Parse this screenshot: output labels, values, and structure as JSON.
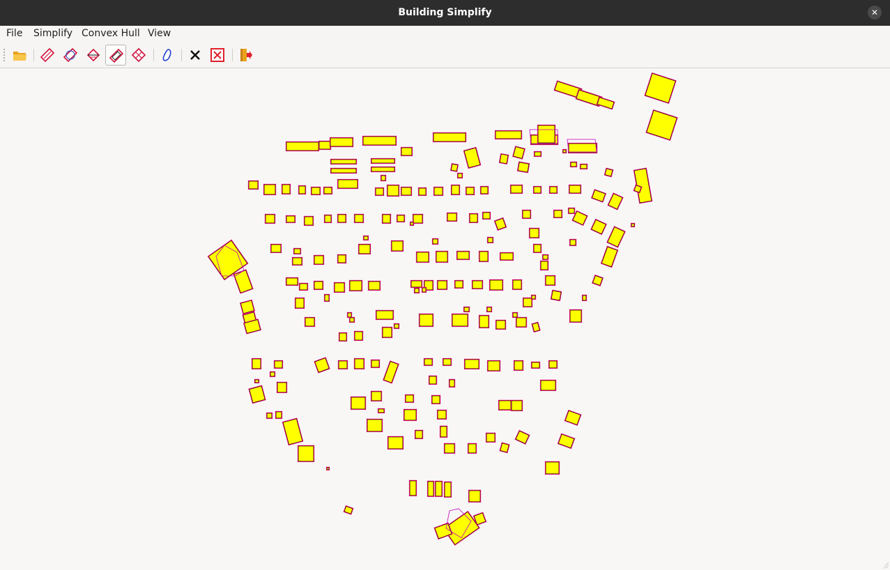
{
  "window": {
    "title": "Building Simplify"
  },
  "menu": {
    "file": "File",
    "simplify": "Simplify",
    "convex_hull": "Convex Hull",
    "view": "View"
  },
  "toolbar": {
    "buttons": [
      "open",
      "simplify-1",
      "simplify-2",
      "simplify-3",
      "simplify-4",
      "simplify-5",
      "convex-hull",
      "clear",
      "clear-all",
      "exit"
    ],
    "checked": "simplify-4"
  },
  "colors": {
    "building_fill": "#ffff00",
    "building_outline": "#000000",
    "simplified_outline": "#e0006e",
    "hull_outline": "#c000c0",
    "canvas": "#f8f7f5"
  }
}
